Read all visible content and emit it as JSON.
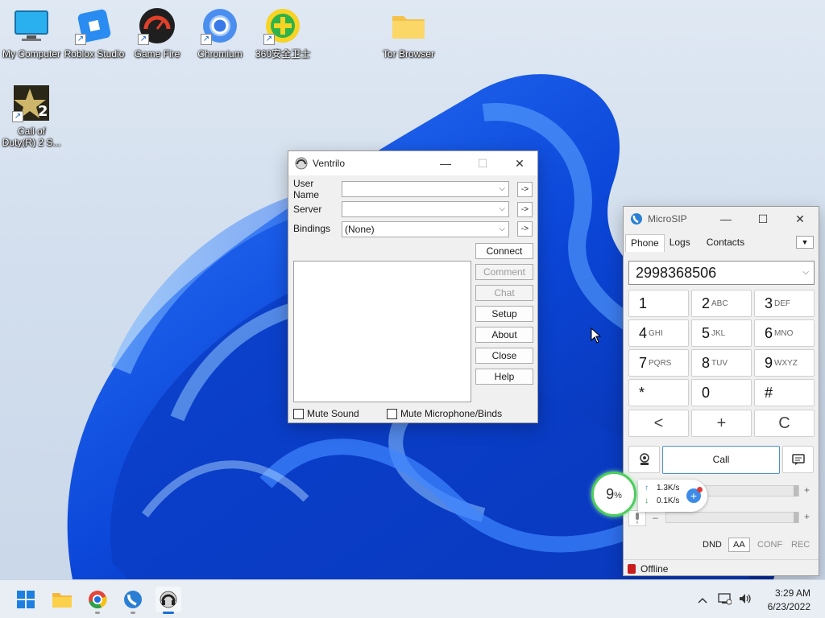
{
  "desktop": {
    "icons": [
      {
        "label": "My Computer"
      },
      {
        "label": "Roblox Studio"
      },
      {
        "label": "Game Fire"
      },
      {
        "label": "Chromium"
      },
      {
        "label": "360安全卫士"
      },
      {
        "label": "Tor Browser"
      },
      {
        "label": "Call of Duty(R) 2 S..."
      }
    ]
  },
  "ventrilo": {
    "title": "Ventrilo",
    "fields": {
      "user_name_label": "User Name",
      "server_label": "Server",
      "bindings_label": "Bindings",
      "user_name_value": "",
      "server_value": "",
      "bindings_value": "(None)"
    },
    "arrow_label": "->",
    "buttons": {
      "connect": "Connect",
      "comment": "Comment",
      "chat": "Chat",
      "setup": "Setup",
      "about": "About",
      "close": "Close",
      "help": "Help"
    },
    "checks": {
      "mute_sound": "Mute Sound",
      "mute_mic": "Mute Microphone/Binds"
    }
  },
  "microsip": {
    "title": "MicroSIP",
    "tabs": [
      "Phone",
      "Logs",
      "Contacts"
    ],
    "number": "2998368506",
    "keypad": [
      {
        "d": "1",
        "l": ""
      },
      {
        "d": "2",
        "l": "ABC"
      },
      {
        "d": "3",
        "l": "DEF"
      },
      {
        "d": "4",
        "l": "GHI"
      },
      {
        "d": "5",
        "l": "JKL"
      },
      {
        "d": "6",
        "l": "MNO"
      },
      {
        "d": "7",
        "l": "PQRS"
      },
      {
        "d": "8",
        "l": "TUV"
      },
      {
        "d": "9",
        "l": "WXYZ"
      },
      {
        "d": "*",
        "l": ""
      },
      {
        "d": "0",
        "l": ""
      },
      {
        "d": "#",
        "l": ""
      }
    ],
    "controls": {
      "back": "<",
      "plus": "+",
      "clear": "C"
    },
    "call_label": "Call",
    "slider_plus": "+",
    "slider_minus": "–",
    "mini_buttons": {
      "dnd": "DND",
      "aa": "AA",
      "conf": "CONF",
      "rec": "REC"
    },
    "status": "Offline"
  },
  "netmeter": {
    "percent": "9",
    "percent_sign": "%",
    "upload": "1.3K/s",
    "download": "0.1K/s"
  },
  "taskbar": {
    "time": "3:29 AM",
    "date": "6/23/2022"
  }
}
